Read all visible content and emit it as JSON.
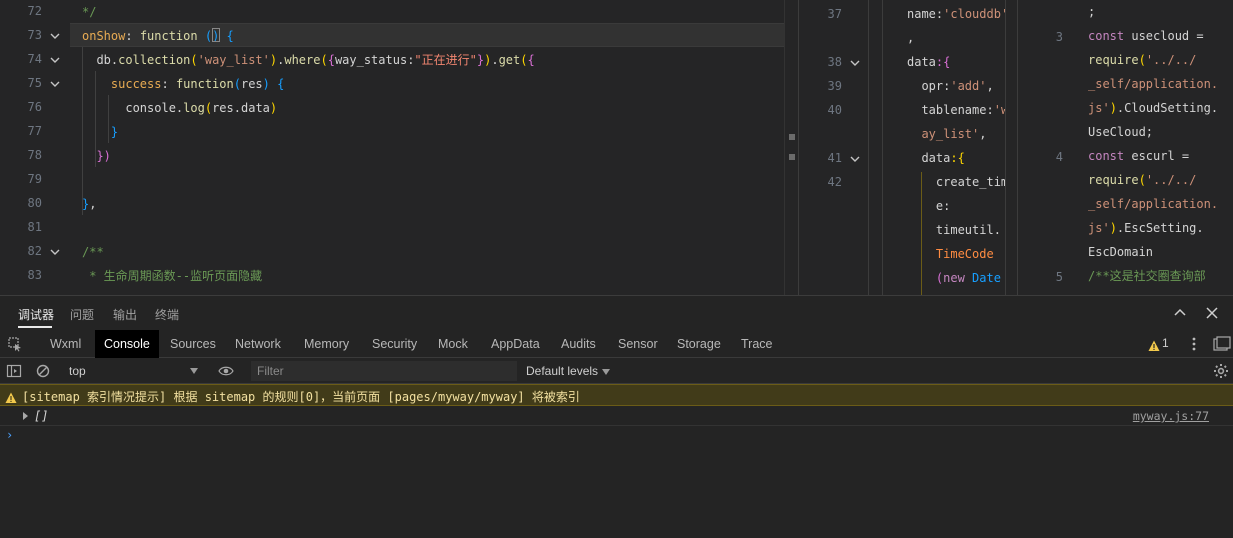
{
  "editor": {
    "main": {
      "lines": [
        {
          "num": "72",
          "fold": false
        },
        {
          "num": "73",
          "fold": true
        },
        {
          "num": "74",
          "fold": true
        },
        {
          "num": "75",
          "fold": true
        },
        {
          "num": "76",
          "fold": false
        },
        {
          "num": "77",
          "fold": false
        },
        {
          "num": "78",
          "fold": false
        },
        {
          "num": "79",
          "fold": false
        },
        {
          "num": "80",
          "fold": false
        },
        {
          "num": "81",
          "fold": false
        },
        {
          "num": "82",
          "fold": true
        },
        {
          "num": "83",
          "fold": false
        }
      ],
      "code": [
        [
          {
            "t": "*/",
            "c": "t-com"
          }
        ],
        [
          {
            "t": "onShow",
            "c": "t-prop"
          },
          {
            "t": ": ",
            "c": "t-var"
          },
          {
            "t": "function",
            "c": "t-fn"
          },
          {
            "t": " ",
            "c": "t-var"
          },
          {
            "t": "()",
            "c": "t-br3"
          },
          {
            "t": " ",
            "c": "t-var"
          },
          {
            "t": "{",
            "c": "t-br3"
          }
        ],
        [
          {
            "t": "  db",
            "c": "t-var"
          },
          {
            "t": ".",
            "c": "t-var"
          },
          {
            "t": "collection",
            "c": "t-fn"
          },
          {
            "t": "(",
            "c": "t-br1"
          },
          {
            "t": "'way_list'",
            "c": "t-str"
          },
          {
            "t": ")",
            "c": "t-br1"
          },
          {
            "t": ".",
            "c": "t-var"
          },
          {
            "t": "where",
            "c": "t-fn"
          },
          {
            "t": "(",
            "c": "t-br1"
          },
          {
            "t": "{",
            "c": "t-br2"
          },
          {
            "t": "way_status",
            "c": "t-var"
          },
          {
            "t": ":",
            "c": "t-var"
          },
          {
            "t": "\"正在进行\"",
            "c": "t-str2"
          },
          {
            "t": "}",
            "c": "t-br2"
          },
          {
            "t": ")",
            "c": "t-br1"
          },
          {
            "t": ".",
            "c": "t-var"
          },
          {
            "t": "get",
            "c": "t-fn"
          },
          {
            "t": "(",
            "c": "t-br1"
          },
          {
            "t": "{",
            "c": "t-br2"
          }
        ],
        [
          {
            "t": "    success",
            "c": "t-prop"
          },
          {
            "t": ": ",
            "c": "t-var"
          },
          {
            "t": "function",
            "c": "t-fn"
          },
          {
            "t": "(",
            "c": "t-br3"
          },
          {
            "t": "res",
            "c": "t-var"
          },
          {
            "t": ")",
            "c": "t-br3"
          },
          {
            "t": " ",
            "c": "t-var"
          },
          {
            "t": "{",
            "c": "t-br3"
          }
        ],
        [
          {
            "t": "      console",
            "c": "t-var"
          },
          {
            "t": ".",
            "c": "t-var"
          },
          {
            "t": "log",
            "c": "t-fn"
          },
          {
            "t": "(",
            "c": "t-br1"
          },
          {
            "t": "res",
            "c": "t-var"
          },
          {
            "t": ".",
            "c": "t-var"
          },
          {
            "t": "data",
            "c": "t-var"
          },
          {
            "t": ")",
            "c": "t-br1"
          }
        ],
        [
          {
            "t": "    }",
            "c": "t-br3"
          }
        ],
        [
          {
            "t": "  })",
            "c": "t-br2"
          }
        ],
        [
          {
            "t": "",
            "c": "t-var"
          }
        ],
        [
          {
            "t": "}",
            "c": "t-br3"
          },
          {
            "t": ",",
            "c": "t-var"
          }
        ],
        [
          {
            "t": "",
            "c": "t-var"
          }
        ],
        [
          {
            "t": "/**",
            "c": "t-com"
          }
        ],
        [
          {
            "t": " * 生命周期函数--监听页面隐藏",
            "c": "t-com"
          }
        ]
      ]
    },
    "mid": {
      "line_numbers": [
        {
          "num": "37",
          "row": 0
        },
        {
          "num": "38",
          "row": 2,
          "fold": true
        },
        {
          "num": "39",
          "row": 3
        },
        {
          "num": "40",
          "row": 4
        },
        {
          "num": "41",
          "row": 6,
          "fold": true
        },
        {
          "num": "42",
          "row": 7
        }
      ],
      "code": [
        [
          {
            "t": "name",
            "c": "t-var"
          },
          {
            "t": ":",
            "c": "t-var"
          },
          {
            "t": "'clouddb'",
            "c": "t-str"
          }
        ],
        [
          {
            "t": ",",
            "c": "t-var"
          }
        ],
        [
          {
            "t": "data",
            "c": "t-var"
          },
          {
            "t": ":{",
            "c": "t-br2"
          }
        ],
        [
          {
            "t": "  opr",
            "c": "t-var"
          },
          {
            "t": ":",
            "c": "t-var"
          },
          {
            "t": "'add'",
            "c": "t-str"
          },
          {
            "t": ",",
            "c": "t-var"
          }
        ],
        [
          {
            "t": "  tablename",
            "c": "t-var"
          },
          {
            "t": ":",
            "c": "t-var"
          },
          {
            "t": "'w",
            "c": "t-str"
          }
        ],
        [
          {
            "t": "  ay_list'",
            "c": "t-str"
          },
          {
            "t": ",",
            "c": "t-var"
          }
        ],
        [
          {
            "t": "  data",
            "c": "t-var"
          },
          {
            "t": ":{",
            "c": "t-br1"
          }
        ],
        [
          {
            "t": "    create_tim",
            "c": "t-var"
          }
        ],
        [
          {
            "t": "    e:",
            "c": "t-var"
          }
        ],
        [
          {
            "t": "    timeutil.",
            "c": "t-var"
          }
        ],
        [
          {
            "t": "    TimeCode",
            "c": "t-orange"
          }
        ],
        [
          {
            "t": "    ",
            "c": "t-var"
          },
          {
            "t": "(",
            "c": "t-br2"
          },
          {
            "t": "new",
            "c": "t-key"
          },
          {
            "t": " Date",
            "c": "t-br3"
          }
        ]
      ]
    },
    "right": {
      "line_numbers": [
        {
          "num": "3",
          "row": 1
        },
        {
          "num": "4",
          "row": 6
        },
        {
          "num": "5",
          "row": 11
        }
      ],
      "code": [
        [
          {
            "t": ";",
            "c": "t-var"
          }
        ],
        [
          {
            "t": "const",
            "c": "t-key"
          },
          {
            "t": " usecloud",
            "c": "t-var"
          },
          {
            "t": " =",
            "c": "t-var"
          }
        ],
        [
          {
            "t": "require",
            "c": "t-fn"
          },
          {
            "t": "(",
            "c": "t-br1"
          },
          {
            "t": "'../../",
            "c": "t-str"
          }
        ],
        [
          {
            "t": "_self/application.",
            "c": "t-str"
          }
        ],
        [
          {
            "t": "js'",
            "c": "t-str"
          },
          {
            "t": ")",
            "c": "t-br1"
          },
          {
            "t": ".CloudSetting.",
            "c": "t-var"
          }
        ],
        [
          {
            "t": "UseCloud",
            "c": "t-var"
          },
          {
            "t": ";",
            "c": "t-var"
          }
        ],
        [
          {
            "t": "const",
            "c": "t-key"
          },
          {
            "t": " escurl",
            "c": "t-var"
          },
          {
            "t": " =",
            "c": "t-var"
          }
        ],
        [
          {
            "t": "require",
            "c": "t-fn"
          },
          {
            "t": "(",
            "c": "t-br1"
          },
          {
            "t": "'../../",
            "c": "t-str"
          }
        ],
        [
          {
            "t": "_self/application.",
            "c": "t-str"
          }
        ],
        [
          {
            "t": "js'",
            "c": "t-str"
          },
          {
            "t": ")",
            "c": "t-br1"
          },
          {
            "t": ".EscSetting.",
            "c": "t-var"
          }
        ],
        [
          {
            "t": "EscDomain",
            "c": "t-var"
          }
        ],
        [
          {
            "t": "/**这是社交圈查询部",
            "c": "t-com"
          }
        ]
      ]
    }
  },
  "devtools": {
    "top_tabs": [
      "调试器",
      "问题",
      "输出",
      "终端"
    ],
    "panel_tabs": [
      "Wxml",
      "Console",
      "Sources",
      "Network",
      "Memory",
      "Security",
      "Mock",
      "AppData",
      "Audits",
      "Sensor",
      "Storage",
      "Trace"
    ],
    "active_panel": "Console",
    "warning_count": "1",
    "toolbar": {
      "context": "top",
      "filter_placeholder": "Filter",
      "levels": "Default levels"
    },
    "messages": {
      "warning": "[sitemap 索引情况提示] 根据 sitemap 的规则[0]，当前页面 [pages/myway/myway] 将被索引",
      "log_value": "[]",
      "log_source": "myway.js:77",
      "prompt": "›"
    },
    "colors": {
      "warning_bg": "#413b19",
      "active_tab_bg": "#000000",
      "prompt": "#4da3ff"
    }
  }
}
